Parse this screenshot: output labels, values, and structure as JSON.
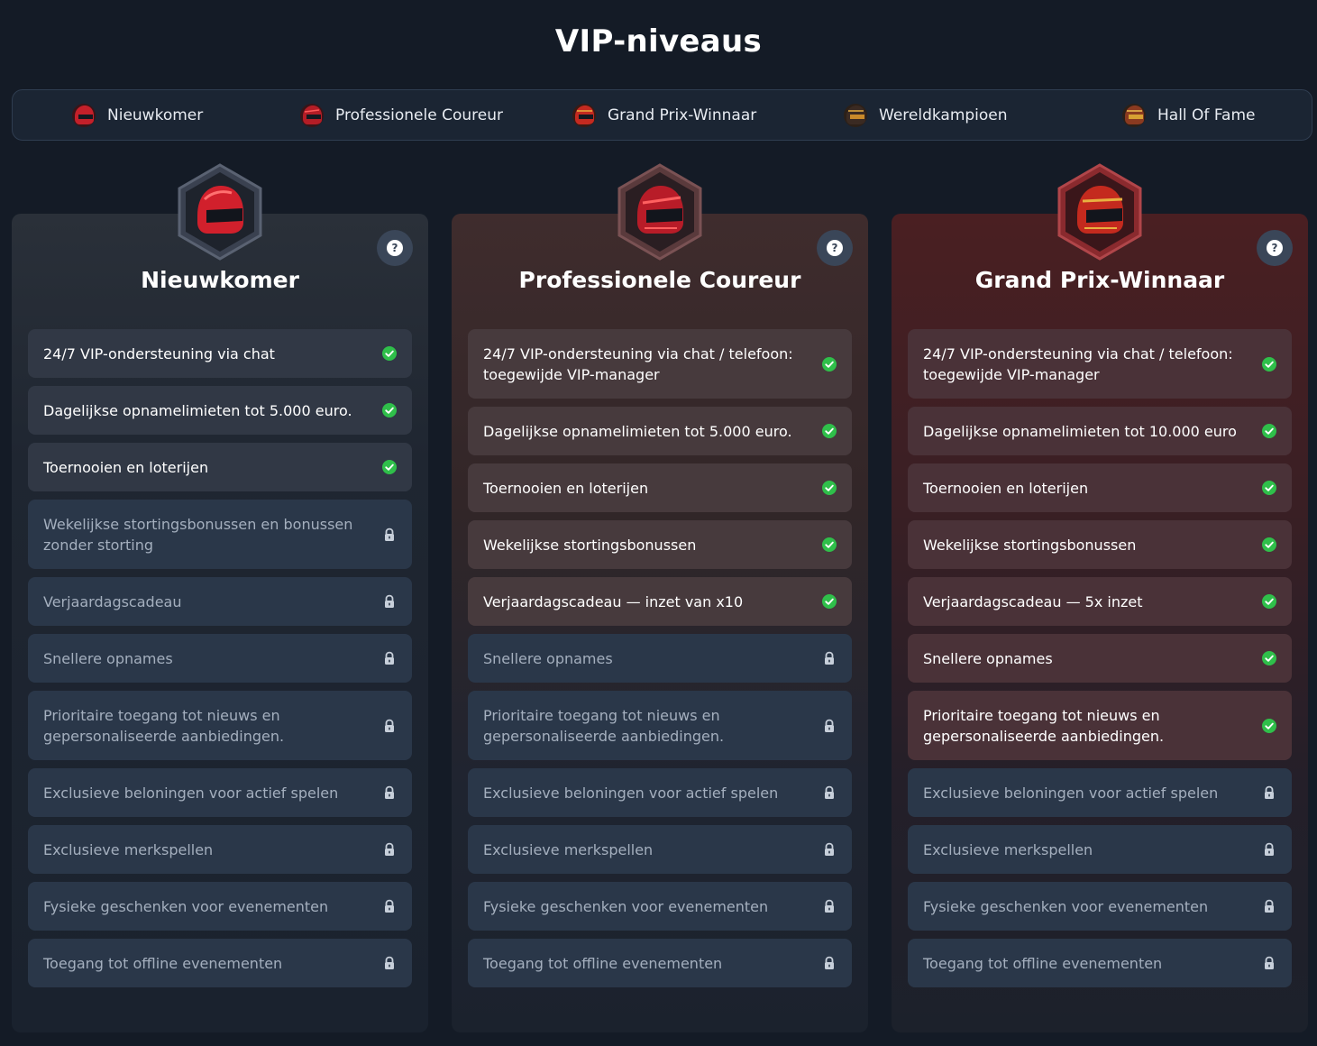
{
  "page_title": "VIP-niveaus",
  "tabs": [
    {
      "label": "Nieuwkomer",
      "icon": "helmet-icon"
    },
    {
      "label": "Professionele Coureur",
      "icon": "helmet-icon"
    },
    {
      "label": "Grand Prix-Winnaar",
      "icon": "helmet-icon"
    },
    {
      "label": "Wereldkampioen",
      "icon": "helmet-icon"
    },
    {
      "label": "Hall Of Fame",
      "icon": "helmet-icon"
    }
  ],
  "help_symbol": "?",
  "colors": {
    "background": "#141b26",
    "check_green": "#2fbf4a",
    "locked_row": "#2a3749",
    "accent_red": "#c62a2a"
  },
  "cards": [
    {
      "name": "Nieuwkomer",
      "features": [
        {
          "text": "24/7 VIP-ondersteuning via chat",
          "status": "included"
        },
        {
          "text": "Dagelijkse opnamelimieten tot 5.000 euro.",
          "status": "included"
        },
        {
          "text": "Toernooien en loterijen",
          "status": "included"
        },
        {
          "text": "Wekelijkse stortingsbonussen en bonussen zonder storting",
          "status": "locked"
        },
        {
          "text": "Verjaardagscadeau",
          "status": "locked"
        },
        {
          "text": "Snellere opnames",
          "status": "locked"
        },
        {
          "text": "Prioritaire toegang tot nieuws en gepersonaliseerde aanbiedingen.",
          "status": "locked"
        },
        {
          "text": "Exclusieve beloningen voor actief spelen",
          "status": "locked"
        },
        {
          "text": "Exclusieve merkspellen",
          "status": "locked"
        },
        {
          "text": "Fysieke geschenken voor evenementen",
          "status": "locked"
        },
        {
          "text": "Toegang tot offline evenementen",
          "status": "locked"
        }
      ]
    },
    {
      "name": "Professionele Coureur",
      "features": [
        {
          "text": "24/7 VIP-ondersteuning via chat / telefoon: toegewijde VIP-manager",
          "status": "included"
        },
        {
          "text": "Dagelijkse opnamelimieten tot 5.000 euro.",
          "status": "included"
        },
        {
          "text": "Toernooien en loterijen",
          "status": "included"
        },
        {
          "text": "Wekelijkse stortingsbonussen",
          "status": "included"
        },
        {
          "text": "Verjaardagscadeau — inzet van x10",
          "status": "included"
        },
        {
          "text": "Snellere opnames",
          "status": "locked"
        },
        {
          "text": "Prioritaire toegang tot nieuws en gepersonaliseerde aanbiedingen.",
          "status": "locked"
        },
        {
          "text": "Exclusieve beloningen voor actief spelen",
          "status": "locked"
        },
        {
          "text": "Exclusieve merkspellen",
          "status": "locked"
        },
        {
          "text": "Fysieke geschenken voor evenementen",
          "status": "locked"
        },
        {
          "text": "Toegang tot offline evenementen",
          "status": "locked"
        }
      ]
    },
    {
      "name": "Grand Prix-Winnaar",
      "features": [
        {
          "text": "24/7 VIP-ondersteuning via chat / telefoon: toegewijde VIP-manager",
          "status": "included"
        },
        {
          "text": "Dagelijkse opnamelimieten tot 10.000 euro",
          "status": "included"
        },
        {
          "text": "Toernooien en loterijen",
          "status": "included"
        },
        {
          "text": "Wekelijkse stortingsbonussen",
          "status": "included"
        },
        {
          "text": "Verjaardagscadeau — 5x inzet",
          "status": "included"
        },
        {
          "text": "Snellere opnames",
          "status": "included"
        },
        {
          "text": "Prioritaire toegang tot nieuws en gepersonaliseerde aanbiedingen.",
          "status": "included"
        },
        {
          "text": "Exclusieve beloningen voor actief spelen",
          "status": "locked"
        },
        {
          "text": "Exclusieve merkspellen",
          "status": "locked"
        },
        {
          "text": "Fysieke geschenken voor evenementen",
          "status": "locked"
        },
        {
          "text": "Toegang tot offline evenementen",
          "status": "locked"
        }
      ]
    }
  ]
}
